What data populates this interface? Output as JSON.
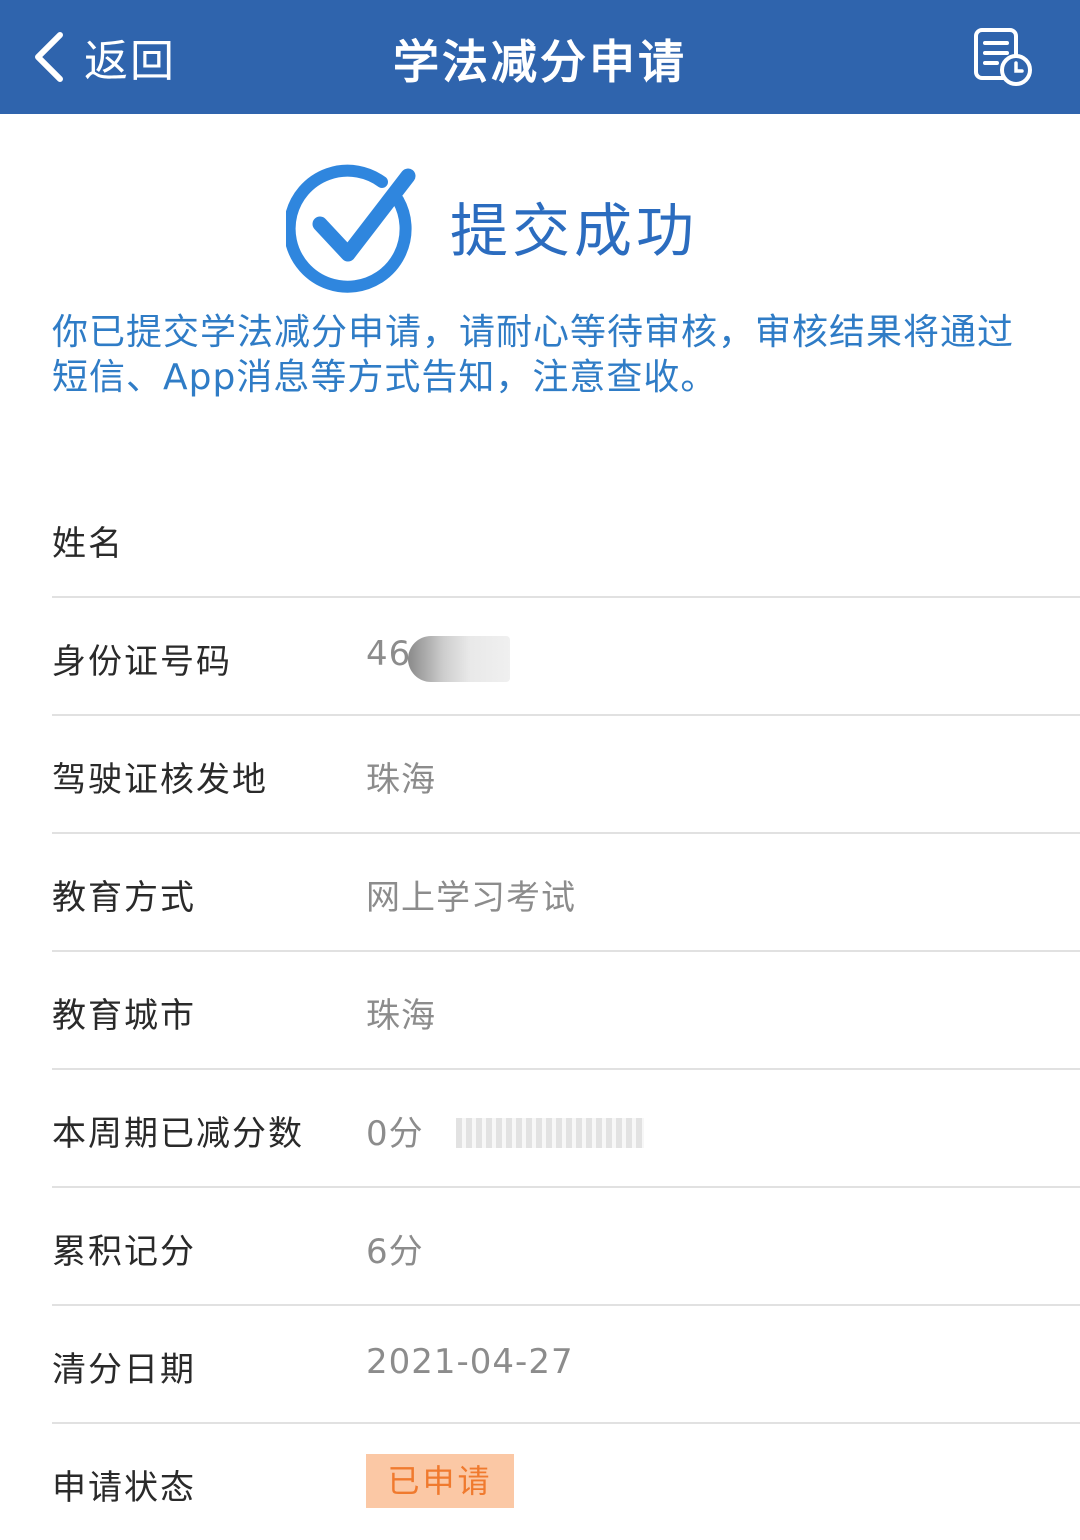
{
  "header": {
    "back_label": "返回",
    "title": "学法减分申请",
    "colors": {
      "bar": "#2f64ad",
      "text": "#ffffff"
    }
  },
  "success": {
    "title": "提交成功",
    "message": "你已提交学法减分申请，请耐心等待审核，审核结果将通过短信、App消息等方式告知，注意查收。"
  },
  "details": {
    "name": {
      "label": "姓名",
      "value": ""
    },
    "id_number": {
      "label": "身份证号码",
      "value": "46"
    },
    "license_place": {
      "label": "驾驶证核发地",
      "value": "珠海"
    },
    "edu_method": {
      "label": "教育方式",
      "value": "网上学习考试"
    },
    "edu_city": {
      "label": "教育城市",
      "value": "珠海"
    },
    "deducted": {
      "label": "本周期已减分数",
      "value": "0分"
    },
    "accumulated": {
      "label": "累积记分",
      "value": "6分"
    },
    "clear_date": {
      "label": "清分日期",
      "value": "2021-04-27"
    },
    "status": {
      "label": "申请状态",
      "value": "已申请"
    }
  },
  "icons": {
    "back": "chevron-left-icon",
    "record": "document-clock-icon",
    "success": "check-circle-icon"
  },
  "colors": {
    "accent": "#2f7cc6",
    "status_bg": "#fbc8a5",
    "status_text": "#f07a2e"
  }
}
